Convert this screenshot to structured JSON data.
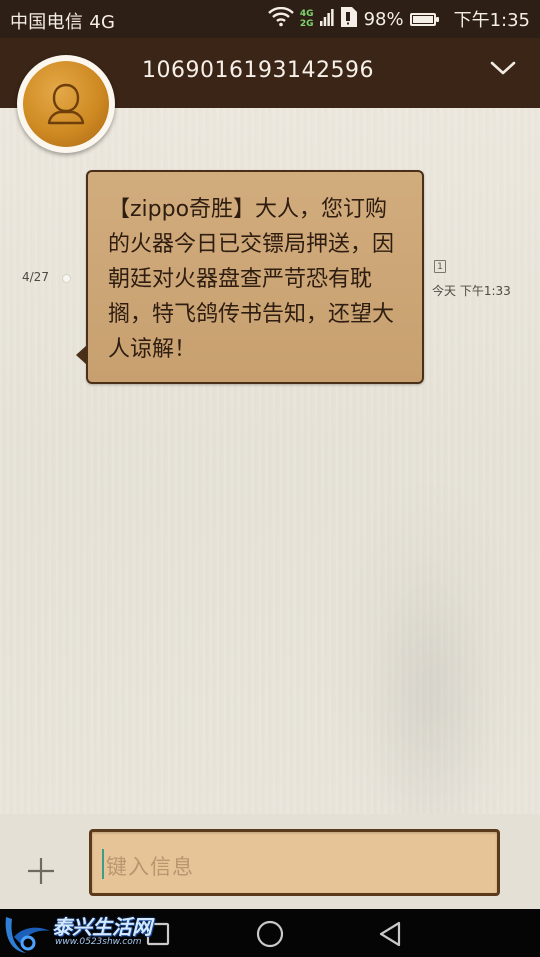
{
  "status_bar": {
    "carrier": "中国电信 4G",
    "net_top": "4G",
    "net_bottom": "2G",
    "battery": "98%",
    "time": "下午1:35"
  },
  "header": {
    "contact_number": "1069016193142596"
  },
  "conversation": {
    "date_marker": "4/27",
    "message": {
      "text": "【zippo奇胜】大人，您订购的火器今日已交镖局押送，因朝廷对火器盘查严苛恐有耽搁，特飞鸽传书告知，还望大人谅解！",
      "sim_slot": "1",
      "time": "今天 下午1:33"
    }
  },
  "composer": {
    "placeholder": "键入信息"
  },
  "watermark": {
    "title": "泰兴生活网",
    "url": "www.0523shw.com"
  },
  "colors": {
    "header_bg": "#3a2517",
    "bubble_bg": "#cfa978",
    "bubble_border": "#4a3019",
    "input_bg": "#e6c497"
  }
}
